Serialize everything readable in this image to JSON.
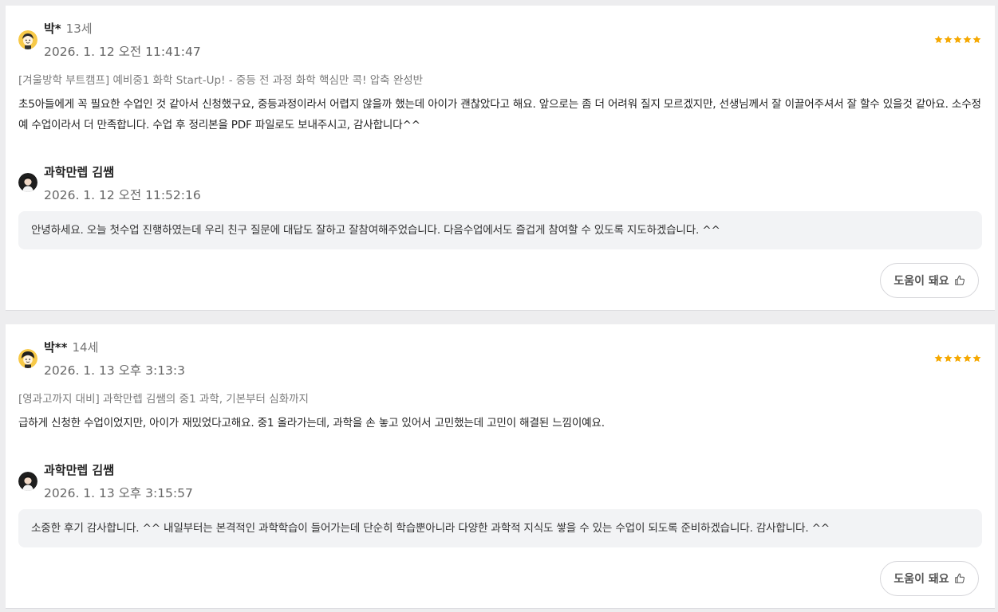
{
  "reviews": [
    {
      "reviewer_name": "박*",
      "reviewer_age": "13세",
      "timestamp": "2026. 1. 12 오전 11:41:47",
      "rating": 5,
      "course_title": "[겨울방학 부트캠프] 예비중1 화학 Start-Up! - 중등 전 과정 화학 핵심만 콕! 압축 완성반",
      "text": "초5아들에게 꼭 필요한 수업인 것 같아서 신청했구요, 중등과정이라서 어렵지 않을까 했는데 아이가 괜찮았다고 해요. 앞으로는 좀 더 어려워 질지 모르겠지만, 선생님께서 잘 이끌어주셔서 잘 할수 있을것 같아요. 소수정예 수업이라서 더 만족합니다. 수업 후 정리본을 PDF 파일로도 보내주시고, 감사합니다^^",
      "reply": {
        "teacher_name": "과학만렙 김쌤",
        "timestamp": "2026. 1. 12 오전 11:52:16",
        "text": "안녕하세요. 오늘 첫수업 진행하였는데 우리 친구 질문에 대답도 잘하고 잘참여해주었습니다. 다음수업에서도 즐겁게 참여할 수 있도록 지도하겠습니다. ^^"
      },
      "helpful_label": "도움이 돼요"
    },
    {
      "reviewer_name": "박**",
      "reviewer_age": "14세",
      "timestamp": "2026. 1. 13 오후 3:13:3",
      "rating": 5,
      "course_title": "[영과고까지 대비] 과학만렙 김쌤의 중1 과학, 기본부터 심화까지",
      "text": "급하게 신청한 수업이었지만, 아이가 재밌었다고해요. 중1 올라가는데, 과학을 손 놓고 있어서 고민했는데 고민이 해결된 느낌이예요.",
      "reply": {
        "teacher_name": "과학만렙 김쌤",
        "timestamp": "2026. 1. 13 오후 3:15:57",
        "text": "소중한 후기 감사합니다. ^^ 내일부터는 본격적인 과학학습이 들어가는데 단순히 학습뿐아니라 다양한 과학적 지식도 쌓을 수 있는 수업이 되도록 준비하겠습니다. 감사합니다. ^^"
      },
      "helpful_label": "도움이 돼요"
    }
  ],
  "colors": {
    "star": "#f5a800",
    "reply_bg": "#f2f3f5",
    "card_bg": "#ffffff",
    "page_bg": "#ededef",
    "muted_text": "#7a7a7a"
  },
  "icons": {
    "rating": "star-icon",
    "helpful": "thumbs-up-icon",
    "reviewer_avatar": "cartoon-child-avatar",
    "teacher_avatar": "teacher-profile-photo"
  }
}
